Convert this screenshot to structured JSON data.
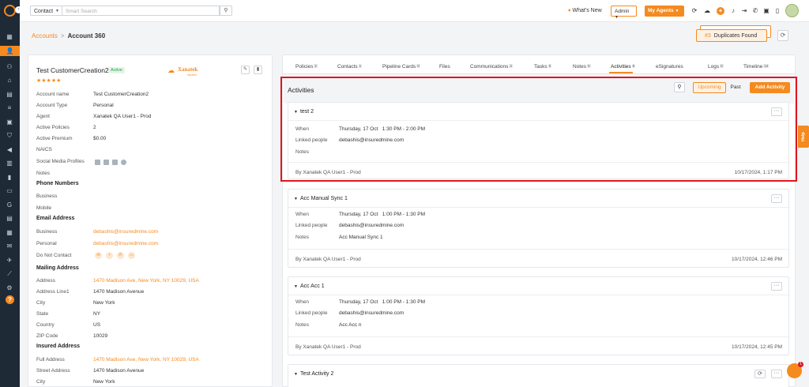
{
  "topbar": {
    "search_type": "Contact",
    "search_placeholder": "Smart Search",
    "whats_new": "What's New",
    "admin_label": "Admin",
    "my_agents_label": "My Agents"
  },
  "breadcrumb": {
    "parent": "Accounts",
    "separator": ">",
    "current": "Account 360"
  },
  "duplicates": {
    "count": "#3",
    "label": "Duplicates Found"
  },
  "account": {
    "name": "Test CustomerCreation2",
    "status": "Active",
    "stars": "★★★★★",
    "logo_text": "Xanatek",
    "logo_sub": "Insured",
    "fields": [
      {
        "label": "Account name",
        "value": "Test CustomerCreation2"
      },
      {
        "label": "Account Type",
        "value": "Personal"
      },
      {
        "label": "Agent",
        "value": "Xanatek QA User1 - Prod"
      },
      {
        "label": "Active Policies",
        "value": "2"
      },
      {
        "label": "Active Premium",
        "value": "$0.00"
      },
      {
        "label": "NAICS",
        "value": ""
      },
      {
        "label": "Social Media Profiles",
        "value": ""
      },
      {
        "label": "Notes",
        "value": ""
      }
    ],
    "phone_section": "Phone Numbers",
    "phone_fields": [
      {
        "label": "Business",
        "value": ""
      },
      {
        "label": "Mobile",
        "value": ""
      }
    ],
    "email_section": "Email Address",
    "email_fields": [
      {
        "label": "Business",
        "value": "debashis@insuredmine.com"
      },
      {
        "label": "Personal",
        "value": "debashis@insuredmine.com"
      },
      {
        "label": "Do Not Contact",
        "value": ""
      }
    ],
    "mailing_section": "Mailing Address",
    "mailing_fields": [
      {
        "label": "Address",
        "value": "1470 Madison Ave, New York, NY 10029, USA"
      },
      {
        "label": "Address Line1",
        "value": "1470 Madison Avenue"
      },
      {
        "label": "City",
        "value": "New York"
      },
      {
        "label": "State",
        "value": "NY"
      },
      {
        "label": "Country",
        "value": "US"
      },
      {
        "label": "ZIP Code",
        "value": "10029"
      }
    ],
    "insured_section": "Insured Address",
    "insured_fields": [
      {
        "label": "Full Address",
        "value": "1470 Madison Ave, New York, NY 10029, USA"
      },
      {
        "label": "Street Address",
        "value": "1470 Madison Avenue"
      },
      {
        "label": "City",
        "value": "New York"
      }
    ]
  },
  "tabs": [
    {
      "label": "Policies",
      "count": "2"
    },
    {
      "label": "Contacts",
      "count": "1"
    },
    {
      "label": "Pipeline Cards",
      "count": "0"
    },
    {
      "label": "Files",
      "count": ""
    },
    {
      "label": "Communications",
      "count": "4"
    },
    {
      "label": "Tasks",
      "count": "0"
    },
    {
      "label": "Notes",
      "count": "0"
    },
    {
      "label": "Activities",
      "count": "6"
    },
    {
      "label": "eSignatures",
      "count": ""
    },
    {
      "label": "Logs",
      "count": "0"
    },
    {
      "label": "Timeline",
      "count": "14"
    }
  ],
  "activities": {
    "title": "Activities",
    "upcoming": "Upcoming",
    "past": "Past",
    "add": "Add Activity",
    "labels": {
      "when": "When",
      "linked": "Linked people",
      "notes": "Notes"
    },
    "items": [
      {
        "title": "test 2",
        "when_date": "Thursday, 17 Oct",
        "when_time": "1:30 PM - 2:00 PM",
        "linked": "debashis@insuredmine.com",
        "notes": "",
        "by": "By Xanatek QA User1 - Prod",
        "timestamp": "10/17/2024, 1:17 PM"
      },
      {
        "title": "Acc Manual Sync 1",
        "when_date": "Thursday, 17 Oct",
        "when_time": "1:00 PM - 1:30 PM",
        "linked": "debashis@insuredmine.com",
        "notes": "Acc Manual Sync 1",
        "by": "By Xanatek QA User1 - Prod",
        "timestamp": "10/17/2024, 12:46 PM"
      },
      {
        "title": "Acc Acc 1",
        "when_date": "Thursday, 17 Oct",
        "when_time": "1:00 PM - 1:30 PM",
        "linked": "debashis@insuredmine.com",
        "notes": "Acc Acc n",
        "by": "By Xanatek QA User1 - Prod",
        "timestamp": "10/17/2024, 12:45 PM"
      },
      {
        "title": "Test Activity 2"
      }
    ]
  },
  "help_tab": "Help",
  "chat_badge": "1",
  "colors": {
    "accent": "#f58a1f",
    "sidebar": "#1f2a37",
    "highlight": "#e0161f"
  }
}
